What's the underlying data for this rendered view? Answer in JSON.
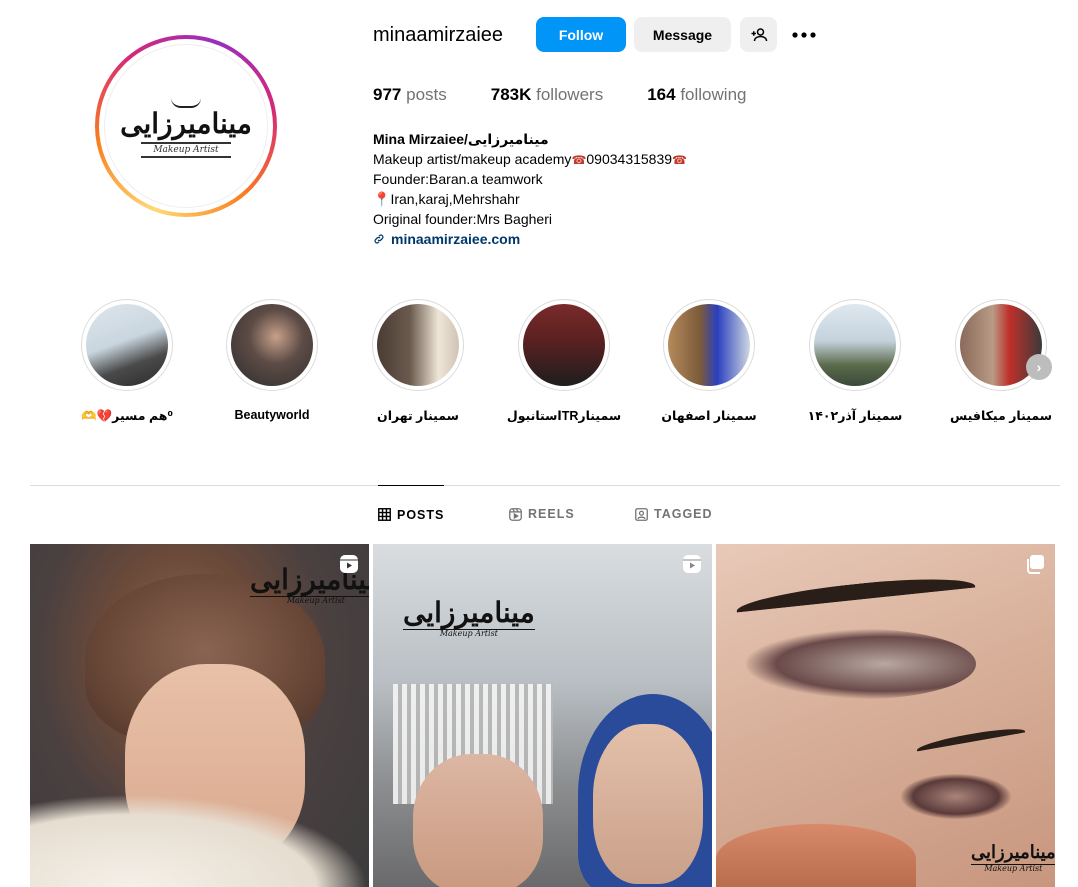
{
  "profile": {
    "username": "minaamirzaiee",
    "avatar_logo_text": "مینامیرزایی",
    "avatar_logo_sub": "Makeup Artist"
  },
  "actions": {
    "follow_label": "Follow",
    "message_label": "Message",
    "add_user_icon": "person-plus-icon",
    "more_icon": "more-horizontal-icon"
  },
  "stats": {
    "posts_value": "977",
    "posts_label": "posts",
    "followers_value": "783K",
    "followers_label": "followers",
    "following_value": "164",
    "following_label": "following"
  },
  "bio": {
    "name": "Mina Mirzaiee/مینامیرزایی",
    "line1_text": "Makeup artist/makeup academy",
    "line1_phone": "09034315839",
    "line2": "Founder:Baran.a teamwork",
    "line3": "Iran,karaj,Mehrshahr",
    "line4": "Original founder:Mrs Bagheri",
    "link": "minaamirzaiee.com"
  },
  "highlights": [
    {
      "label": "⁰هم مسیر💔🫶",
      "colors": [
        "#c9d6df",
        "#3a3a3a"
      ]
    },
    {
      "label": "Beautyworld",
      "colors": [
        "#5d4c46",
        "#2b2b2b"
      ]
    },
    {
      "label": "سمینار تهران",
      "colors": [
        "#6a5a4e",
        "#efe6d8"
      ]
    },
    {
      "label": "سمینارTRاستانبول",
      "colors": [
        "#7a2a2a",
        "#1e1e1e"
      ]
    },
    {
      "label": "سمینار اصفهان",
      "colors": [
        "#b58a5a",
        "#2a3fbf"
      ]
    },
    {
      "label": "سمینار آذر۱۴۰۲",
      "colors": [
        "#dfe8ef",
        "#5a6a4a"
      ]
    },
    {
      "label": "سمینار میکافیس",
      "colors": [
        "#8a6a5a",
        "#c0302a"
      ]
    }
  ],
  "tabs": [
    {
      "label": "POSTS",
      "icon": "grid-icon"
    },
    {
      "label": "REELS",
      "icon": "reels-icon"
    },
    {
      "label": "TAGGED",
      "icon": "tagged-icon"
    }
  ],
  "posts": [
    {
      "type": "reel",
      "badge_icon": "reel-icon",
      "watermark": "مینامیرزایی",
      "watermark_sub": "Makeup Artist"
    },
    {
      "type": "reel",
      "badge_icon": "reel-icon",
      "watermark": "مینامیرزایی",
      "watermark_sub": "Makeup Artist"
    },
    {
      "type": "carousel",
      "badge_icon": "carousel-icon",
      "watermark": "مینامیرزایی",
      "watermark_sub": "Makeup Artist"
    }
  ]
}
